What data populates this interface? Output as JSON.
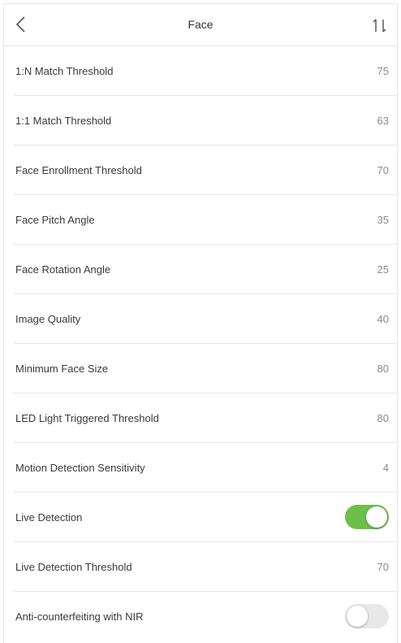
{
  "header": {
    "title": "Face",
    "back_icon": "chevron-left-icon",
    "sort_icon": "sort-icon"
  },
  "colors": {
    "toggle_on": "#6cc04a",
    "toggle_off": "#e8e8e8",
    "divider": "#e6e6e6"
  },
  "rows": [
    {
      "label": "1:N Match Threshold",
      "value": "75"
    },
    {
      "label": "1:1 Match Threshold",
      "value": "63"
    },
    {
      "label": "Face Enrollment Threshold",
      "value": "70"
    },
    {
      "label": "Face Pitch Angle",
      "value": "35"
    },
    {
      "label": "Face Rotation Angle",
      "value": "25"
    },
    {
      "label": "Image Quality",
      "value": "40"
    },
    {
      "label": "Minimum Face Size",
      "value": "80"
    },
    {
      "label": "LED Light Triggered Threshold",
      "value": "80"
    },
    {
      "label": "Motion Detection Sensitivity",
      "value": "4"
    },
    {
      "label": "Live Detection",
      "toggle": true
    },
    {
      "label": "Live Detection Threshold",
      "value": "70"
    },
    {
      "label": "Anti-counterfeiting with NIR",
      "toggle": false
    }
  ]
}
